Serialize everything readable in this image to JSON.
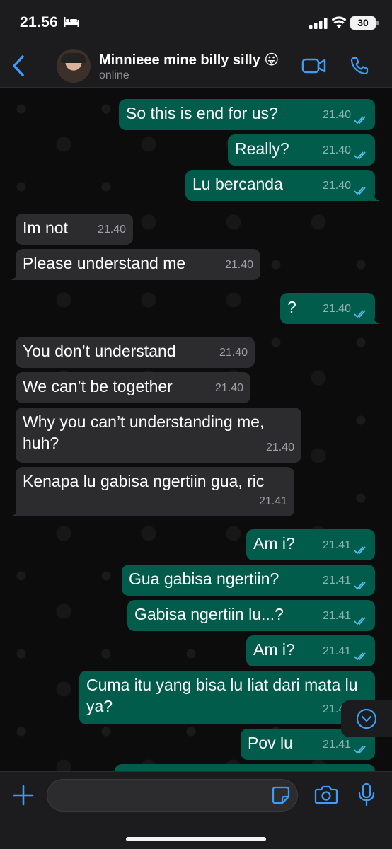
{
  "status_bar": {
    "time": "21.56",
    "battery": "30"
  },
  "header": {
    "contact_name": "Minnieee mine billy silly 😛",
    "status": "online"
  },
  "messages": [
    {
      "dir": "out",
      "text": "So this is end for us?",
      "time": "21.40",
      "read": true
    },
    {
      "dir": "out",
      "text": "Really?",
      "time": "21.40",
      "read": true
    },
    {
      "dir": "out",
      "text": "Lu bercanda",
      "time": "21.40",
      "read": true
    },
    {
      "dir": "in",
      "text": "Im not",
      "time": "21.40"
    },
    {
      "dir": "in",
      "text": "Please understand me",
      "time": "21.40"
    },
    {
      "dir": "out",
      "text": "?",
      "time": "21.40",
      "read": true
    },
    {
      "dir": "in",
      "text": "You don’t understand",
      "time": "21.40"
    },
    {
      "dir": "in",
      "text": "We can’t be together",
      "time": "21.40"
    },
    {
      "dir": "in",
      "text": "Why you can’t understanding me, huh?",
      "time": "21.40"
    },
    {
      "dir": "in",
      "text": "Kenapa lu gabisa ngertiin gua, ric",
      "time": "21.41"
    },
    {
      "dir": "out",
      "text": "Am i?",
      "time": "21.41",
      "read": true
    },
    {
      "dir": "out",
      "text": "Gua gabisa ngertiin?",
      "time": "21.41",
      "read": true
    },
    {
      "dir": "out",
      "text": "Gabisa ngertiin lu...?",
      "time": "21.41",
      "read": true
    },
    {
      "dir": "out",
      "text": "Am i?",
      "time": "21.41",
      "read": true
    },
    {
      "dir": "out",
      "text": "Cuma itu yang bisa lu liat dari mata lu ya?",
      "time": "21.41",
      "read": true
    },
    {
      "dir": "out",
      "text": "Pov lu",
      "time": "21.41",
      "read": true
    }
  ],
  "input": {
    "value": "",
    "placeholder": ""
  },
  "colors": {
    "accent": "#3d9df6",
    "outgoing_bubble": "#015c4b",
    "incoming_bubble": "#2c2c2e",
    "read_tick": "#53bdeb"
  }
}
